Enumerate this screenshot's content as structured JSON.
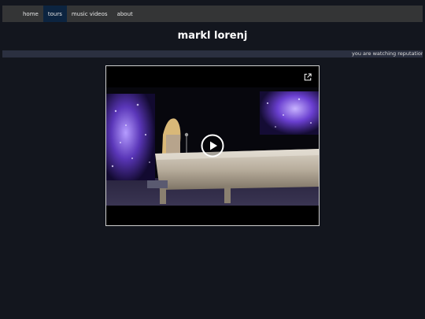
{
  "nav": {
    "items": [
      {
        "label": "home",
        "active": false
      },
      {
        "label": "tours",
        "active": true
      },
      {
        "label": "music videos",
        "active": false
      },
      {
        "label": "about",
        "active": false
      }
    ]
  },
  "site": {
    "title": "markl lorenj"
  },
  "marquee": {
    "text": "you are watching reputation s"
  },
  "video": {
    "external_icon": "external-link-icon",
    "play_icon": "play-icon"
  },
  "colors": {
    "background": "#13161e",
    "navbar": "#343536",
    "nav_active": "#0c2440",
    "marquee_bar": "#2b3040"
  }
}
